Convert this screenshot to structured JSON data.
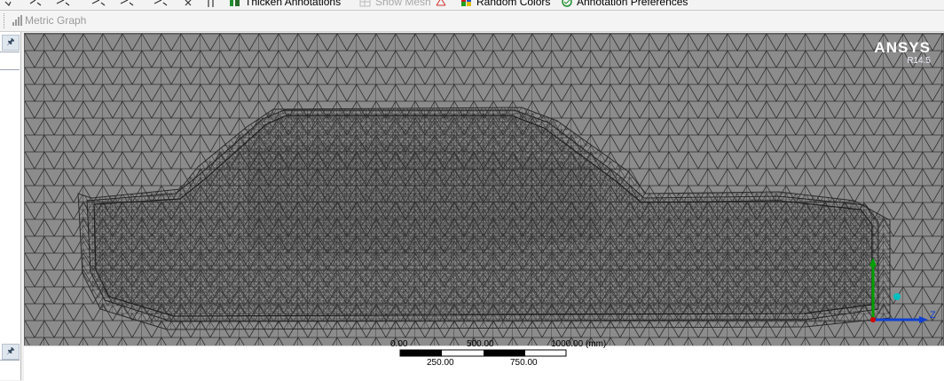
{
  "toolbar": {
    "items": [
      {
        "label": "Thicken Annotations",
        "icon": "thicken-annotations-icon",
        "enabled": true
      },
      {
        "label": "Show Mesh",
        "icon": "show-mesh-icon",
        "enabled": false
      },
      {
        "label": "Random Colors",
        "icon": "random-colors-icon",
        "enabled": true
      },
      {
        "label": "Annotation Preferences",
        "icon": "annotation-preferences-icon",
        "enabled": true
      }
    ]
  },
  "toolbar2": {
    "metric_graph_label": "Metric Graph"
  },
  "viewport": {
    "brand": "ANSYS",
    "version": "R14.5",
    "background_color": "#8a8a8a",
    "mesh_color": "#2e2e2e",
    "triad": {
      "x_color": "#d00000",
      "y_color": "#00a000",
      "z_color": "#1040d0",
      "z_label": "Z"
    }
  },
  "scale": {
    "top_labels": [
      "0.00",
      "500.00",
      "1000.00 (mm)"
    ],
    "bottom_labels": [
      "250.00",
      "750.00"
    ]
  },
  "left_panel": {
    "pin_icon": "pin-icon"
  }
}
